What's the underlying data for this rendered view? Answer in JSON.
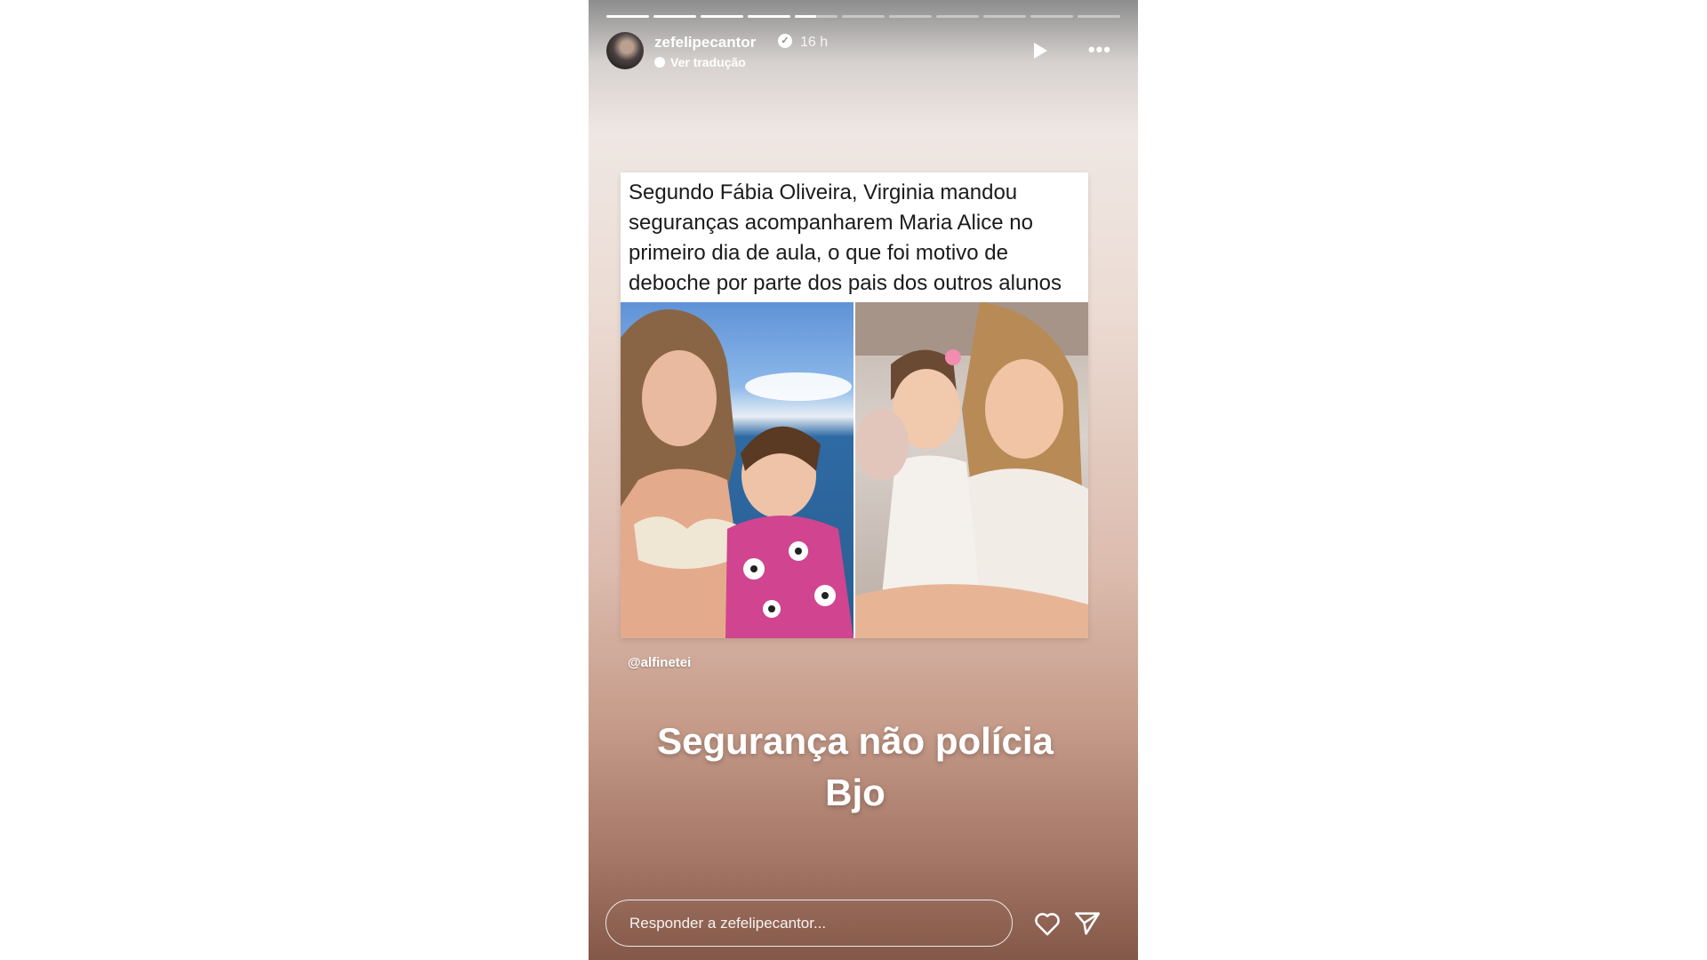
{
  "story": {
    "progress": {
      "segments": 11,
      "completed": 4,
      "current_fraction": 0.5
    },
    "header": {
      "username": "zefelipecantor",
      "verified": true,
      "time_ago": "16 h",
      "translate_label": "Ver tradução",
      "icons": {
        "avatar": "profile-avatar",
        "verified": "verified-badge-icon",
        "play": "play-icon",
        "more": "more-options-icon"
      }
    },
    "post": {
      "text": "Segundo Fábia Oliveira, Virginia mandou seguranças acompanharem Maria Alice no primeiro dia de aula, o que foi motivo de deboche por parte dos pais dos outros alunos",
      "credit": "@alfinetei"
    },
    "caption": {
      "line1": "Segurança não polícia",
      "line2": "Bjo"
    },
    "footer": {
      "reply_placeholder": "Responder a zefelipecantor...",
      "icons": {
        "like": "heart-icon",
        "share": "send-icon"
      }
    }
  }
}
